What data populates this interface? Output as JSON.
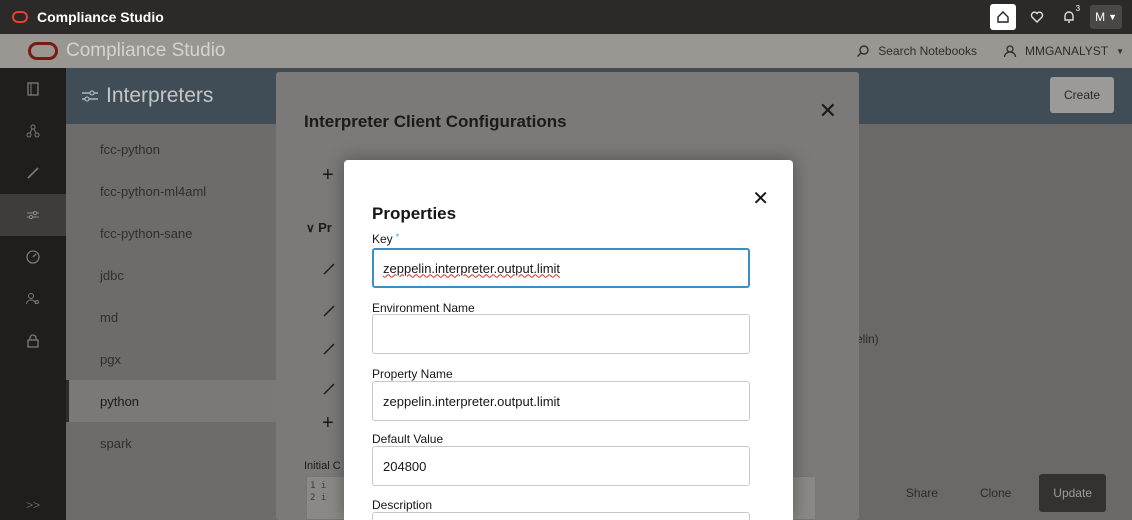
{
  "window": {
    "title": "Compliance Studio",
    "notification_count": "3",
    "user_initial": "M"
  },
  "appbar": {
    "title": "Compliance Studio",
    "search_label": "Search Notebooks",
    "user_label": "MMGANALYST"
  },
  "page": {
    "title": "Interpreters",
    "create_label": "Create"
  },
  "rail": {
    "collapse_label": ">>",
    "items": [
      "notebook-icon",
      "graph-icon",
      "edit-icon",
      "interpreters-icon",
      "gauge-icon",
      "users-icon",
      "lock-icon"
    ]
  },
  "interpreters": [
    "fcc-python",
    "fcc-python-ml4aml",
    "fcc-python-sane",
    "jdbc",
    "md",
    "pgx",
    "python",
    "spark"
  ],
  "selected_interpreter": "python",
  "content": {
    "side_text": "elin)",
    "share_label": "Share",
    "clone_label": "Clone",
    "update_label": "Update"
  },
  "outer_dialog": {
    "title": "Interpreter Client Configurations",
    "section_prefix": "Pr",
    "initial_label": "Initial C",
    "code_lines": [
      "1 i",
      "2 i"
    ]
  },
  "properties_dialog": {
    "title": "Properties",
    "key_label": "Key",
    "required_marker": "*",
    "key_value": "zeppelin.interpreter.output.limit",
    "env_label": "Environment Name",
    "env_value": "",
    "property_name_label": "Property Name",
    "property_name_value": "zeppelin.interpreter.output.limit",
    "default_value_label": "Default Value",
    "default_value": "204800",
    "description_label": "Description"
  },
  "colors": {
    "brand": "#e2442e",
    "focus": "#3b8fc7",
    "required": "#2ba8c4"
  }
}
